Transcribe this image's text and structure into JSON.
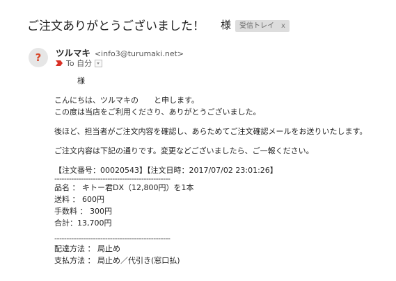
{
  "subject": {
    "title": "ご注文ありがとうございました！",
    "honorific": "様",
    "label": "受信トレイ",
    "label_close": "x"
  },
  "sender": {
    "avatar_glyph": "?",
    "name": "ツルマキ",
    "email": "<info3@turumaki.net>",
    "to_label": "To 自分",
    "importance_icon": "importance-marker-icon"
  },
  "body": {
    "salutation": "　　　様",
    "greeting1": "こんにちは、ツルマキの　　と申します。",
    "greeting2": "この度は当店をご利用くださり、ありがとうございました。",
    "notice": "後ほど、担当者がご注文内容を確認し、あらためてご注文確認メールをお送りいたします。",
    "request": "ご注文内容は下記の通りです。変更などございましたら、ご一報ください。",
    "order_header": "【注文番号：00020543】【注文日時：2017/07/02 23:01:26】",
    "divider1": "------------------------------------------------",
    "product": "品名 ： キトー君DX（12,800円）を1本",
    "shipping": "送料 ： 600円",
    "fee": "手数料 ： 300円",
    "total": "合計：13,700円",
    "divider2": "------------------------------------------------",
    "delivery": "配達方法 ： 局止め",
    "payment": "支払方法 ： 局止め／代引き(窓口払)"
  },
  "colors": {
    "avatar_glyph": "#d8492b",
    "chip_bg": "#dddddd",
    "importance": "#d93025"
  }
}
